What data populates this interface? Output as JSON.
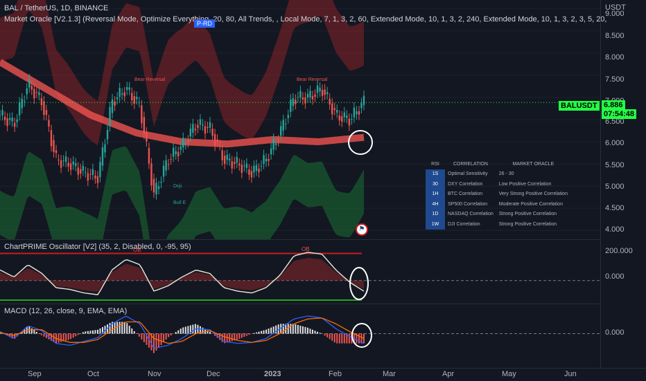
{
  "header": {
    "symbol_line": "BAL / TetherUS, 1D, BINANCE",
    "indicator_line": "Market Oracle [V2.1.3] (Reversal Mode, Optimize Everything, 20, 80, All Trends, , Local Mode, 7, 1, 3, 2, 60, Extended Mode, 10, 1, 3, 2, 240, Extended Mode, 10, 1, 3, 2, 3, 5, 20,"
  },
  "price_axis": {
    "currency": "USDT",
    "ticks": [
      "9.000",
      "8.500",
      "8.000",
      "7.500",
      "7.000",
      "6.500",
      "6.000",
      "5.500",
      "5.000",
      "4.500",
      "4.000"
    ],
    "last_price": "6.886",
    "countdown": "07:54:48",
    "symbol_tag": "BALUSDT"
  },
  "osc_axis": {
    "ticks": [
      "200.000",
      "0.000"
    ]
  },
  "macd_axis": {
    "ticks": [
      "0.000"
    ]
  },
  "time_axis": {
    "labels": [
      "Sep",
      "Oct",
      "Nov",
      "Dec",
      "2023",
      "Feb",
      "Mar",
      "Apr",
      "May",
      "Jun"
    ]
  },
  "chart_labels": {
    "p_rd": "P-RD",
    "bear_reversal_1": "Bear Reversal",
    "bear_reversal_2": "Bear Reversal",
    "doji": "Doji",
    "bull_e": "Bull E",
    "ob_1": "OB",
    "ob_2": "OB"
  },
  "correlation_table": {
    "headers": [
      "RSI",
      "CORRELATION",
      "MARKET ORACLE"
    ],
    "rows": [
      {
        "tf": "1S",
        "name": "Optimal Sensitivity",
        "value": "26 - 30"
      },
      {
        "tf": "30",
        "name": "DXY Correlation",
        "value": "Low Positive Correlation"
      },
      {
        "tf": "1H",
        "name": "BTC Correlation",
        "value": "Very Strong Positive Correlation"
      },
      {
        "tf": "4H",
        "name": "SP500 Correlation",
        "value": "Moderate Positive Correlation"
      },
      {
        "tf": "1D",
        "name": "NASDAQ Correlation",
        "value": "Strong Positive Correlation"
      },
      {
        "tf": "1W",
        "name": "DJI Correlation",
        "value": "Strong Positive Correlation"
      }
    ]
  },
  "panes": {
    "oscillator_title": "ChartPRIME Oscillator [V2] (35, 2, Disabled, 0, -95, 95)",
    "macd_title": "MACD (12, 26, close, 9, EMA, EMA)"
  },
  "colors": {
    "background": "#131722",
    "bull": "#26a69a",
    "bear": "#ef5350",
    "price_line": "#22ff44",
    "ob_line": "#c81e1e",
    "os_line": "#1fa81f",
    "macd_line": "#2962ff",
    "signal_line": "#ff6d00"
  },
  "chart_data": [
    {
      "type": "candlestick",
      "title": "BAL / TetherUS, 1D, BINANCE",
      "x": [
        "Aug-15",
        "Aug-22",
        "Aug-29",
        "Sep-05",
        "Sep-12",
        "Sep-19",
        "Sep-26",
        "Oct-03",
        "Oct-10",
        "Oct-17",
        "Oct-24",
        "Oct-31",
        "Nov-07",
        "Nov-14",
        "Nov-21",
        "Nov-28",
        "Dec-05",
        "Dec-12",
        "Dec-19",
        "Dec-26",
        "Jan-02",
        "Jan-09",
        "Jan-16",
        "Jan-23",
        "Jan-30",
        "Feb-06",
        "Feb-13"
      ],
      "close": [
        6.6,
        6.4,
        7.3,
        6.9,
        5.6,
        5.5,
        5.3,
        5.2,
        6.9,
        7.2,
        6.8,
        4.8,
        5.6,
        5.9,
        6.4,
        6.3,
        5.6,
        5.5,
        5.3,
        5.6,
        6.2,
        7.0,
        7.0,
        7.2,
        6.6,
        6.5,
        6.9
      ],
      "ylim": [
        3.8,
        9.2
      ],
      "last_price": 6.886
    },
    {
      "type": "line",
      "title": "ChartPRIME Oscillator [V2] (35, 2, Disabled, 0, -95, 95)",
      "x": [
        "Aug-15",
        "Aug-22",
        "Aug-29",
        "Sep-05",
        "Sep-12",
        "Sep-19",
        "Sep-26",
        "Oct-03",
        "Oct-10",
        "Oct-17",
        "Oct-24",
        "Oct-31",
        "Nov-07",
        "Nov-14",
        "Nov-21",
        "Nov-28",
        "Dec-05",
        "Dec-12",
        "Dec-19",
        "Dec-26",
        "Jan-02",
        "Jan-09",
        "Jan-16",
        "Jan-23",
        "Jan-30",
        "Feb-06",
        "Feb-13"
      ],
      "series": [
        {
          "values": [
            60,
            20,
            90,
            40,
            -40,
            -50,
            -70,
            -80,
            60,
            120,
            90,
            -60,
            -30,
            20,
            60,
            40,
            -40,
            -60,
            -70,
            -40,
            30,
            140,
            160,
            150,
            60,
            -10,
            -60
          ]
        }
      ],
      "levels": [
        95,
        -95
      ]
    },
    {
      "type": "bar",
      "title": "MACD (12, 26, close, 9, EMA, EMA)",
      "x": [
        "Aug-15",
        "Aug-22",
        "Aug-29",
        "Sep-05",
        "Sep-12",
        "Sep-19",
        "Sep-26",
        "Oct-03",
        "Oct-10",
        "Oct-17",
        "Oct-24",
        "Oct-31",
        "Nov-07",
        "Nov-14",
        "Nov-21",
        "Nov-28",
        "Dec-05",
        "Dec-12",
        "Dec-19",
        "Dec-26",
        "Jan-02",
        "Jan-09",
        "Jan-16",
        "Jan-23",
        "Jan-30",
        "Feb-06",
        "Feb-13"
      ],
      "series": [
        {
          "values": [
            0.02,
            -0.05,
            0.08,
            0.03,
            -0.1,
            -0.12,
            -0.08,
            -0.04,
            0.1,
            0.18,
            0.1,
            -0.15,
            -0.12,
            -0.05,
            0.05,
            0.04,
            -0.08,
            -0.1,
            -0.09,
            -0.05,
            0.05,
            0.15,
            0.18,
            0.16,
            0.05,
            -0.03,
            -0.1
          ]
        },
        {
          "values": [
            0.01,
            -0.02,
            0.04,
            0.04,
            -0.05,
            -0.09,
            -0.09,
            -0.06,
            0.04,
            0.12,
            0.12,
            -0.05,
            -0.1,
            -0.08,
            0.0,
            0.03,
            -0.03,
            -0.07,
            -0.09,
            -0.07,
            0.0,
            0.1,
            0.15,
            0.16,
            0.1,
            0.02,
            -0.05
          ]
        }
      ]
    }
  ]
}
